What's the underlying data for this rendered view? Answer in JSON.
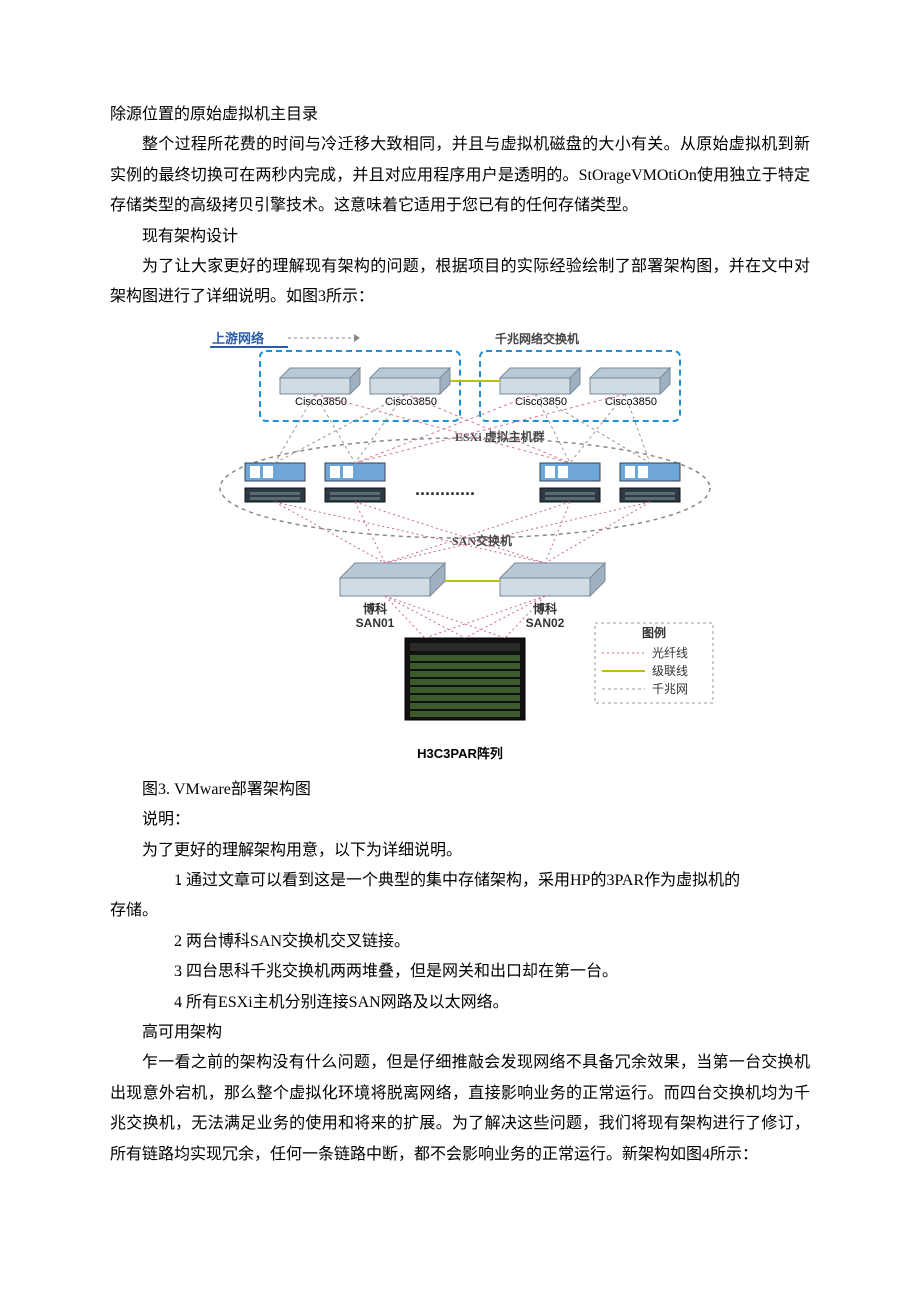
{
  "para": {
    "p1": "除源位置的原始虚拟机主目录",
    "p2": "整个过程所花费的时间与冷迁移大致相同，并且与虚拟机磁盘的大小有关。从原始虚拟机到新实例的最终切换可在两秒内完成，并且对应用程序用户是透明的。StOrageVMOtiOn使用独立于特定存储类型的高级拷贝引擎技术。这意味着它适用于您已有的任何存储类型。",
    "h1": "现有架构设计",
    "p3": "为了让大家更好的理解现有架构的问题，根据项目的实际经验绘制了部署架构图，并在文中对架构图进行了详细说明。如图3所示：",
    "fig_caption": "图3. VMware部署架构图",
    "p4": "说明：",
    "p5": "为了更好的理解架构用意，以下为详细说明。",
    "li1_num": "1",
    "li1": " . 通过文章可以看到这是一个典型的集中存储架构，采用HP的3PAR作为虚拟机的存储。",
    "li2_num": "2",
    "li2": " . 两台博科SAN交换机交叉链接。",
    "li3_num": "3",
    "li3": " . 四台思科千兆交换机两两堆叠，但是网关和出口却在第一台。",
    "li4_num": "4",
    "li4": " . 所有ESXi主机分别连接SAN网路及以太网络。",
    "h2": "高可用架构",
    "p6": "乍一看之前的架构没有什么问题，但是仔细推敲会发现网络不具备冗余效果，当第一台交换机出现意外宕机，那么整个虚拟化环境将脱离网络，直接影响业务的正常运行。而四台交换机均为千兆交换机，无法满足业务的使用和将来的扩展。为了解决这些问题，我们将现有架构进行了修订，所有链路均实现冗余，任何一条链路中断，都不会影响业务的正常运行。新架构如图4所示："
  },
  "diagram": {
    "upstream": "上游网络",
    "switches_title": "千兆网络交换机",
    "switch_label": "Cisco3850",
    "esxi_title": "ESXi 虚拟主机群",
    "san_title": "SAN交换机",
    "san1_t": "博科",
    "san1_b": "SAN01",
    "san2_t": "博科",
    "san2_b": "SAN02",
    "legend_title": "图例",
    "legend_fiber": "光纤线",
    "legend_cascade": "级联线",
    "legend_gigabit": "千兆网",
    "array_label": "H3C3PAR阵列"
  }
}
